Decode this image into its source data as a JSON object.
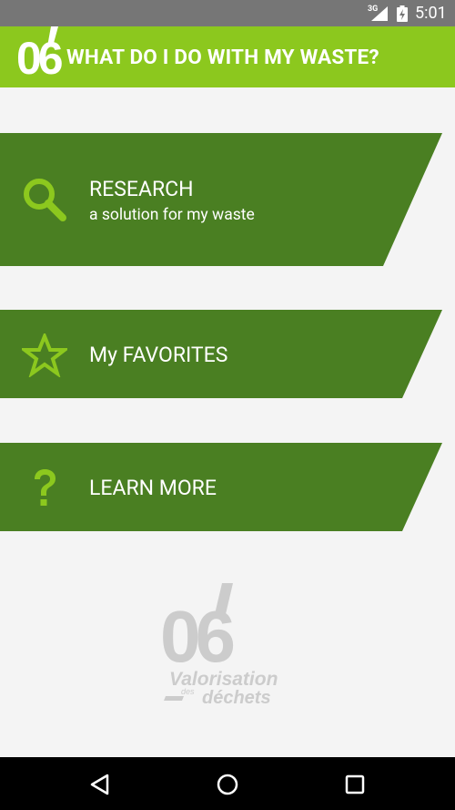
{
  "status_bar": {
    "network": "3G",
    "time": "5:01"
  },
  "app_bar": {
    "logo_text": "06",
    "title": "WHAT DO I DO WITH MY WASTE?"
  },
  "menu": {
    "research": {
      "label": "RESEARCH",
      "sublabel": "a solution for my waste",
      "icon": "search-icon"
    },
    "favorites": {
      "label": "My FAVORITES",
      "icon": "star-icon"
    },
    "learn_more": {
      "label": "LEARN MORE",
      "icon": "question-mark-icon"
    }
  },
  "footer_logo": {
    "number": "06",
    "line1": "Valorisation",
    "line2_small": "des",
    "line2": "déchets"
  },
  "nav_bar": {
    "back": "back-icon",
    "home": "home-icon",
    "recents": "recents-icon"
  },
  "colors": {
    "status_bar": "#767676",
    "app_bar": "#8cc81e",
    "card": "#4a7f22",
    "icon_accent": "#8cc81e",
    "background": "#f4f4f4",
    "logo_gray": "#cccccc"
  }
}
